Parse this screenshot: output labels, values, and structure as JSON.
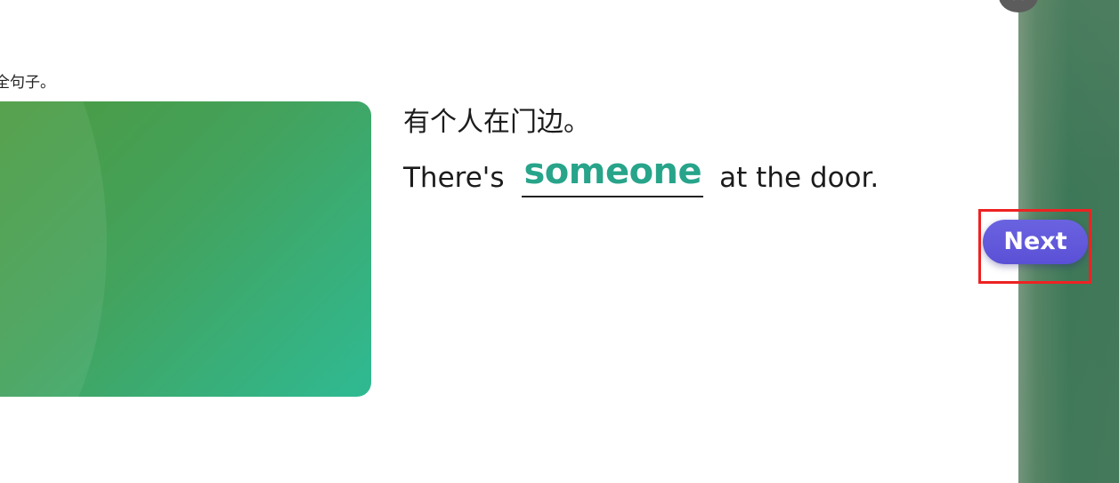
{
  "instruction": {
    "text": "全句子。"
  },
  "exercise": {
    "chinese_sentence": "有个人在门边。",
    "english_before": "There's",
    "answer": "someone",
    "english_after": "at the door."
  },
  "navigation": {
    "next_label": "Next"
  },
  "icons": {
    "close": "close-icon"
  },
  "colors": {
    "answer_text": "#27a48a",
    "next_button": "#5a50d6",
    "highlight_border": "#ee2222",
    "image_gradient_start": "#4c9a3f",
    "image_gradient_end": "#2fba93"
  }
}
